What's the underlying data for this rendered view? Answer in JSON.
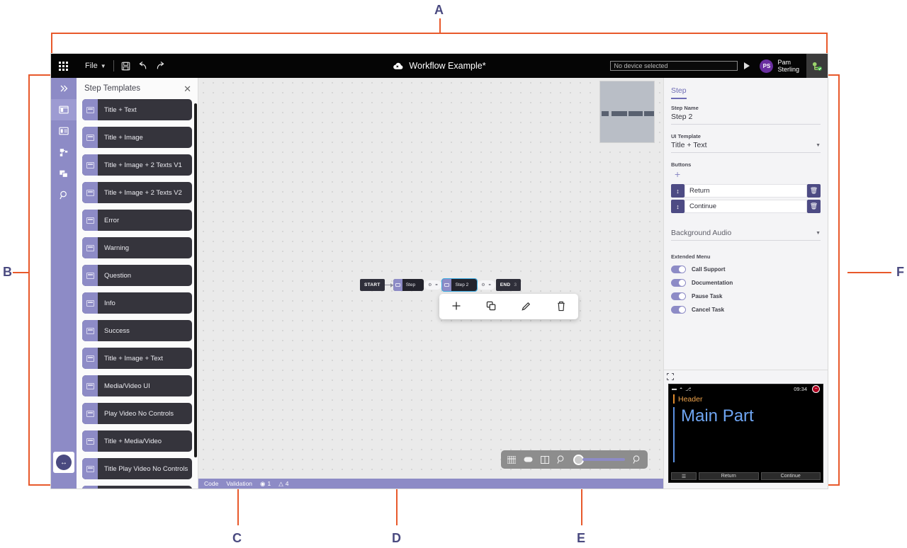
{
  "annotations": [
    {
      "id": "A",
      "label": "A"
    },
    {
      "id": "B",
      "label": "B"
    },
    {
      "id": "C",
      "label": "C"
    },
    {
      "id": "D",
      "label": "D"
    },
    {
      "id": "E",
      "label": "E"
    },
    {
      "id": "F",
      "label": "F"
    }
  ],
  "topbar": {
    "apps_icon": "grid-apps-icon",
    "file_menu": "File",
    "save_icon": "save-icon",
    "undo_icon": "undo-icon",
    "redo_icon": "redo-icon",
    "cloud_icon": "cloud-offline-icon",
    "document_title": "Workflow Example*",
    "device_placeholder": "No device selected",
    "device_value": "",
    "play_icon": "play-icon",
    "user_initials": "PS",
    "user_first_name": "Pam",
    "user_last_name": "Sterling",
    "connection_icon": "connection-ok-icon"
  },
  "rail": {
    "collapse_icon": "chevron-double-right-icon",
    "items": [
      {
        "name": "step-templates",
        "icon": "layout-template-icon",
        "active": true
      },
      {
        "name": "properties",
        "icon": "panel-list-icon",
        "active": false
      },
      {
        "name": "workflow-tree",
        "icon": "hierarchy-icon",
        "active": false
      },
      {
        "name": "assets",
        "icon": "layers-icon",
        "active": false
      },
      {
        "name": "search",
        "icon": "search-icon",
        "active": false
      }
    ],
    "bottom_icon": "resize-horizontal-icon"
  },
  "templates_panel": {
    "title": "Step Templates",
    "close_icon": "close-icon",
    "items": [
      {
        "label": "Title + Text"
      },
      {
        "label": "Title + Image"
      },
      {
        "label": "Title + Image + 2 Texts V1"
      },
      {
        "label": "Title + Image + 2 Texts V2"
      },
      {
        "label": "Error"
      },
      {
        "label": "Warning"
      },
      {
        "label": "Question"
      },
      {
        "label": "Info"
      },
      {
        "label": "Success"
      },
      {
        "label": "Title + Image + Text"
      },
      {
        "label": "Media/Video UI"
      },
      {
        "label": "Play Video No Controls"
      },
      {
        "label": "Title + Media/Video"
      },
      {
        "label": "Title Play Video No Controls"
      },
      {
        "label": ""
      }
    ]
  },
  "canvas": {
    "minimap": "minimap",
    "flow": {
      "start_label": "START",
      "end_label": "END",
      "end_count": "3",
      "nodes": [
        {
          "label": "Step",
          "selected": false
        },
        {
          "label": "Step 2",
          "selected": true
        }
      ]
    },
    "edit_toolbar": [
      {
        "name": "add-step-button",
        "icon": "plus-icon",
        "glyph": "+"
      },
      {
        "name": "duplicate-step-button",
        "icon": "copy-icon",
        "glyph": "❐"
      },
      {
        "name": "edit-step-button",
        "icon": "pencil-icon",
        "glyph": "✎"
      },
      {
        "name": "delete-step-button",
        "icon": "trash-icon",
        "glyph": "Ὕ1"
      }
    ],
    "zoom_toolbar": [
      {
        "name": "grid-toggle-button",
        "icon": "grid-icon"
      },
      {
        "name": "fit-width-button",
        "icon": "rectangle-icon"
      },
      {
        "name": "book-view-button",
        "icon": "book-icon"
      },
      {
        "name": "zoom-out-button",
        "icon": "zoom-out-icon"
      },
      {
        "name": "zoom-slider",
        "icon": "slider-icon"
      },
      {
        "name": "zoom-in-button",
        "icon": "zoom-in-icon"
      }
    ]
  },
  "statusbar": {
    "code_label": "Code",
    "validation_label": "Validation",
    "error_icon": "error-circle-icon",
    "error_count": "1",
    "warning_icon": "warning-triangle-icon",
    "warning_count": "4"
  },
  "rightpanel": {
    "tab": "Step",
    "step_name_label": "Step Name",
    "step_name_value": "Step 2",
    "ui_template_label": "UI Template",
    "ui_template_value": "Title + Text",
    "buttons_label": "Buttons",
    "add_button_icon": "plus-icon",
    "buttons": [
      {
        "label": "Return",
        "drag_icon": "drag-handle-icon",
        "delete_icon": "trash-icon"
      },
      {
        "label": "Continue",
        "drag_icon": "drag-handle-icon",
        "delete_icon": "trash-icon"
      }
    ],
    "background_audio_label": "Background Audio",
    "extended_menu_label": "Extended Menu",
    "toggles": [
      {
        "label": "Call Support",
        "on": true
      },
      {
        "label": "Documentation",
        "on": true
      },
      {
        "label": "Pause Task",
        "on": true
      },
      {
        "label": "Cancel Task",
        "on": true
      }
    ],
    "expand_icon": "expand-preview-icon"
  },
  "device_preview": {
    "battery_icon": "battery-icon",
    "wifi_icon": "wifi-icon",
    "mic_icon": "microphone-icon",
    "time": "09:34",
    "badge_icon": "do-not-disturb-icon",
    "header_text": "Header",
    "main_text": "Main Part",
    "buttons": [
      {
        "label": "",
        "icon": "menu-icon"
      },
      {
        "label": "Return"
      },
      {
        "label": "Continue"
      }
    ]
  },
  "colors": {
    "accent_purple": "#8d8bc6",
    "dark_node": "#23232c",
    "annotation_orange": "#e8592b",
    "annotation_label": "#4a4a80",
    "selection_blue": "#39a9e0"
  }
}
